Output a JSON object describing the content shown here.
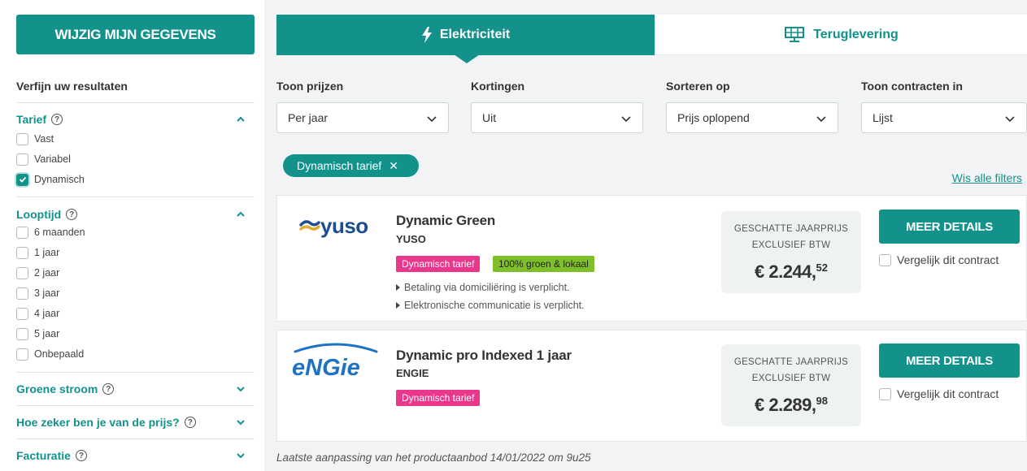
{
  "sidebar": {
    "edit_button": "WIJZIG MIJN GEGEVENS",
    "refine_title": "Verfijn uw resultaten",
    "tarief": {
      "title": "Tarief",
      "options": [
        {
          "label": "Vast",
          "checked": false
        },
        {
          "label": "Variabel",
          "checked": false
        },
        {
          "label": "Dynamisch",
          "checked": true
        }
      ]
    },
    "looptijd": {
      "title": "Looptijd",
      "options": [
        {
          "label": "6 maanden",
          "checked": false
        },
        {
          "label": "1 jaar",
          "checked": false
        },
        {
          "label": "2 jaar",
          "checked": false
        },
        {
          "label": "3 jaar",
          "checked": false
        },
        {
          "label": "4 jaar",
          "checked": false
        },
        {
          "label": "5 jaar",
          "checked": false
        },
        {
          "label": "Onbepaald",
          "checked": false
        }
      ]
    },
    "groene_stroom": "Groene stroom",
    "zekerheid": "Hoe zeker ben je van de prijs?",
    "facturatie": "Facturatie"
  },
  "tabs": {
    "elec": "Elektriciteit",
    "terug": "Teruglevering"
  },
  "filters": {
    "prices": {
      "label": "Toon prijzen",
      "value": "Per jaar"
    },
    "discounts": {
      "label": "Kortingen",
      "value": "Uit"
    },
    "sort": {
      "label": "Sorteren op",
      "value": "Prijs oplopend"
    },
    "view": {
      "label": "Toon contracten in",
      "value": "Lijst"
    }
  },
  "active_chip": "Dynamisch tarief",
  "clear_filters": "Wis alle filters",
  "products": [
    {
      "logo": "yuso",
      "name": "Dynamic Green",
      "provider": "YUSO",
      "badges": [
        "Dynamisch tarief",
        "100% groen & lokaal"
      ],
      "notes": [
        "Betaling via domiciliëring is verplicht.",
        "Elektronische communicatie is verplicht."
      ],
      "price_label_1": "GESCHATTE JAARPRIJS",
      "price_label_2": "EXCLUSIEF BTW",
      "price_main": "€ 2.244,",
      "price_cents": "52",
      "details": "MEER DETAILS",
      "compare": "Vergelijk dit contract"
    },
    {
      "logo": "engie",
      "name": "Dynamic pro Indexed 1 jaar",
      "provider": "ENGIE",
      "badges": [
        "Dynamisch tarief"
      ],
      "notes": [],
      "price_label_1": "GESCHATTE JAARPRIJS",
      "price_label_2": "EXCLUSIEF BTW",
      "price_main": "€ 2.289,",
      "price_cents": "98",
      "details": "MEER DETAILS",
      "compare": "Vergelijk dit contract"
    }
  ],
  "footer": "Laatste aanpassing van het productaanbod 14/01/2022 om 9u25",
  "colors": {
    "accent": "#13928c",
    "pink": "#e9378c",
    "green": "#7fbf2a"
  },
  "logos": {
    "yuso": "yuso",
    "engie": "eNGie"
  }
}
